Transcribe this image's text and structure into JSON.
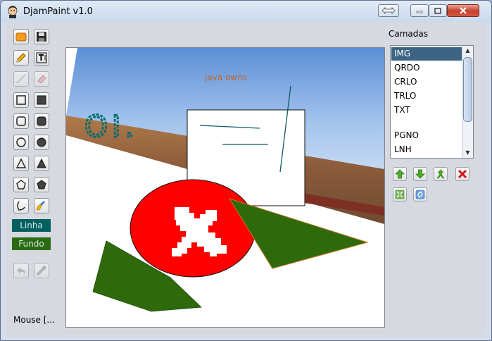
{
  "window": {
    "title": "DjamPaint v1.0"
  },
  "canvas": {
    "overlay_text": "java owns",
    "drawn_text": "OI."
  },
  "toolbar": {
    "line_color_label": "Linha",
    "fill_color_label": "Fundo",
    "line_color": "#006060",
    "fill_color": "#2a6b12"
  },
  "layers": {
    "title": "Camadas",
    "items": [
      {
        "label": "IMG",
        "selected": true
      },
      {
        "label": "QRDO",
        "selected": false
      },
      {
        "label": "CRLO",
        "selected": false
      },
      {
        "label": "TRLO",
        "selected": false
      },
      {
        "label": "TXT",
        "selected": false
      },
      {
        "label": "",
        "selected": false
      },
      {
        "label": "PGNO",
        "selected": false
      },
      {
        "label": "LNH",
        "selected": false
      }
    ]
  },
  "status": {
    "text": "Mouse [..."
  }
}
